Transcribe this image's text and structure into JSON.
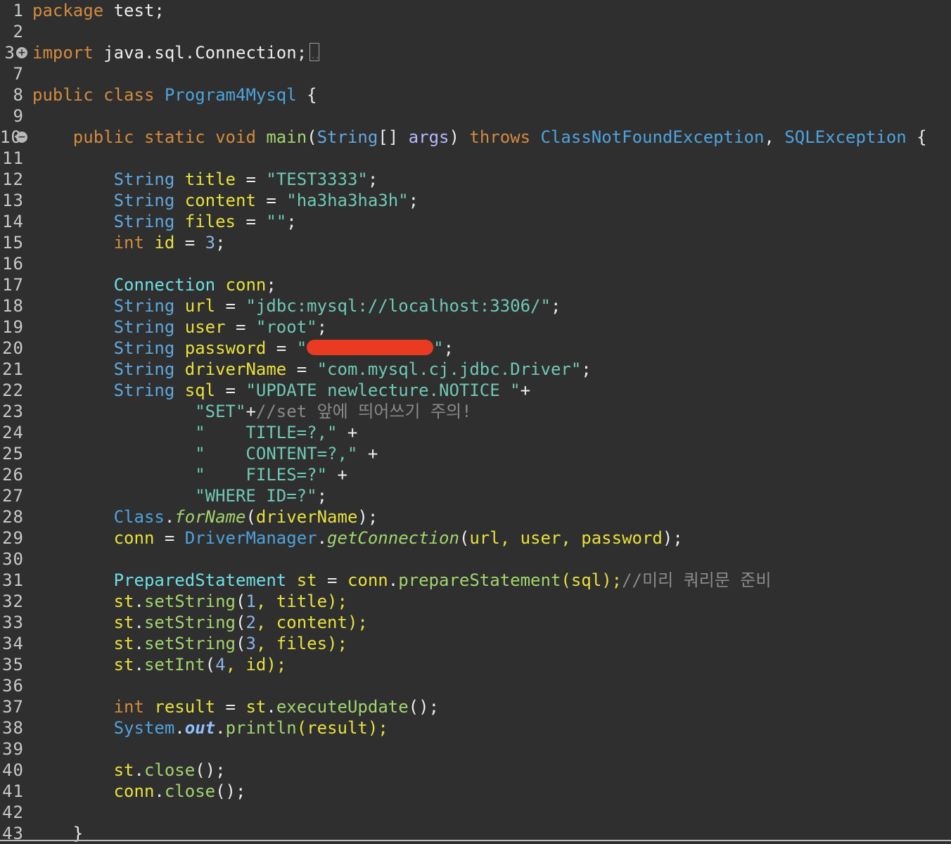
{
  "editor": {
    "package_line": {
      "num": "1",
      "kw": "package",
      "rest": " test;"
    },
    "blank2": {
      "num": "2"
    },
    "import_line": {
      "num": "3",
      "kw": "import",
      "rest": " java.sql.Connection;"
    },
    "blank7": {
      "num": "7"
    },
    "class_line": {
      "num": "8",
      "kw1": "public",
      "kw2": "class",
      "cls": "Program4Mysql",
      "rest": " {"
    },
    "blank9": {
      "num": "9"
    },
    "main_line": {
      "num": "10",
      "kw1": "public",
      "kw2": "static",
      "kw3": "void",
      "fn": "main",
      "ty": "String",
      "arr": "[] ",
      "arg": "args",
      "close": ") ",
      "throws": "throws",
      "ex1": "ClassNotFoundException",
      "comma": ", ",
      "ex2": "SQLException",
      "brace": " {"
    },
    "l11": {
      "num": "11"
    },
    "l12": {
      "num": "12",
      "ty": "String",
      "var": "title",
      "eq": " = ",
      "str": "\"TEST3333\"",
      "end": ";"
    },
    "l13": {
      "num": "13",
      "ty": "String",
      "var": "content",
      "eq": " = ",
      "str": "\"ha3ha3ha3h\"",
      "end": ";"
    },
    "l14": {
      "num": "14",
      "ty": "String",
      "var": "files",
      "eq": " = ",
      "str": "\"\"",
      "end": ";"
    },
    "l15": {
      "num": "15",
      "ty": "int",
      "var": "id",
      "eq": " = ",
      "numv": "3",
      "end": ";"
    },
    "l16": {
      "num": "16"
    },
    "l17": {
      "num": "17",
      "ty": "Connection",
      "var": "conn",
      "end": ";"
    },
    "l18": {
      "num": "18",
      "ty": "String",
      "var": "url",
      "eq": " = ",
      "str": "\"jdbc:mysql://localhost:3306/\"",
      "end": ";"
    },
    "l19": {
      "num": "19",
      "ty": "String",
      "var": "user",
      "eq": " = ",
      "str": "\"root\"",
      "end": ";"
    },
    "l20": {
      "num": "20",
      "ty": "String",
      "var": "password",
      "eq": " = ",
      "str_open": "\"",
      "str_close": "\"",
      "end": ";"
    },
    "l21": {
      "num": "21",
      "ty": "String",
      "var": "driverName",
      "eq": " = ",
      "str": "\"com.mysql.cj.jdbc.Driver\"",
      "end": ";"
    },
    "l22": {
      "num": "22",
      "ty": "String",
      "var": "sql",
      "eq": " = ",
      "str": "\"UPDATE newlecture.NOTICE \"",
      "end": "+"
    },
    "l23": {
      "num": "23",
      "str": "\"SET\"",
      "plus": "+",
      "cmt": "//set 앞에 띄어쓰기 주의!"
    },
    "l24": {
      "num": "24",
      "str": "\"    TITLE=?,\"",
      "plus": " +"
    },
    "l25": {
      "num": "25",
      "str": "\"    CONTENT=?,\"",
      "plus": " +"
    },
    "l26": {
      "num": "26",
      "str": "\"    FILES=?\"",
      "plus": " +"
    },
    "l27": {
      "num": "27",
      "str": "\"WHERE ID=?\"",
      "end": ";"
    },
    "l28": {
      "num": "28",
      "cls": "Class",
      "dot": ".",
      "fn": "forName",
      "open": "(",
      "arg": "driverName",
      "end": ");"
    },
    "l29": {
      "num": "29",
      "var": "conn",
      "eq": " = ",
      "cls": "DriverManager",
      "dot": ".",
      "fn": "getConnection",
      "open": "(",
      "args": "url, user, password",
      "end": ");"
    },
    "l30": {
      "num": "30"
    },
    "l31": {
      "num": "31",
      "ty": "PreparedStatement",
      "var": "st",
      "eq": " = ",
      "obj": "conn",
      "dot": ".",
      "fn": "prepareStatement",
      "args": "(sql);",
      "cmt": "//미리 쿼리문 준비"
    },
    "l32": {
      "num": "32",
      "obj": "st",
      "dot": ".",
      "fn": "setString",
      "open": "(",
      "n": "1",
      "rest": ", title);"
    },
    "l33": {
      "num": "33",
      "obj": "st",
      "dot": ".",
      "fn": "setString",
      "open": "(",
      "n": "2",
      "rest": ", content);"
    },
    "l34": {
      "num": "34",
      "obj": "st",
      "dot": ".",
      "fn": "setString",
      "open": "(",
      "n": "3",
      "rest": ", files);"
    },
    "l35": {
      "num": "35",
      "obj": "st",
      "dot": ".",
      "fn": "setInt",
      "open": "(",
      "n": "4",
      "rest": ", id);"
    },
    "l36": {
      "num": "36"
    },
    "l37": {
      "num": "37",
      "ty": "int",
      "var": "result",
      "eq": " = ",
      "obj": "st",
      "dot": ".",
      "fn": "executeUpdate",
      "end": "();"
    },
    "l38": {
      "num": "38",
      "cls": "System",
      "dot": ".",
      "out": "out",
      "dot2": ".",
      "fn": "println",
      "args": "(result);"
    },
    "l39": {
      "num": "39"
    },
    "l40": {
      "num": "40",
      "obj": "st",
      "dot": ".",
      "fn": "close",
      "end": "();"
    },
    "l41": {
      "num": "41",
      "obj": "conn",
      "dot": ".",
      "fn": "close",
      "end": "();"
    },
    "l42": {
      "num": "42"
    },
    "l43": {
      "num": "43",
      "brace": "}"
    }
  },
  "icons": {
    "fold_expand": "plus-circle-icon",
    "fold_collapse": "minus-circle-icon"
  },
  "colors": {
    "background": "#2f2f2f",
    "keyword": "#d38b3e",
    "type": "#5fa8e0",
    "variable": "#e8e13c",
    "string": "#6ec9b6",
    "method": "#a3d46d",
    "comment": "#8a8a8a",
    "redaction": "#ea3a22"
  }
}
